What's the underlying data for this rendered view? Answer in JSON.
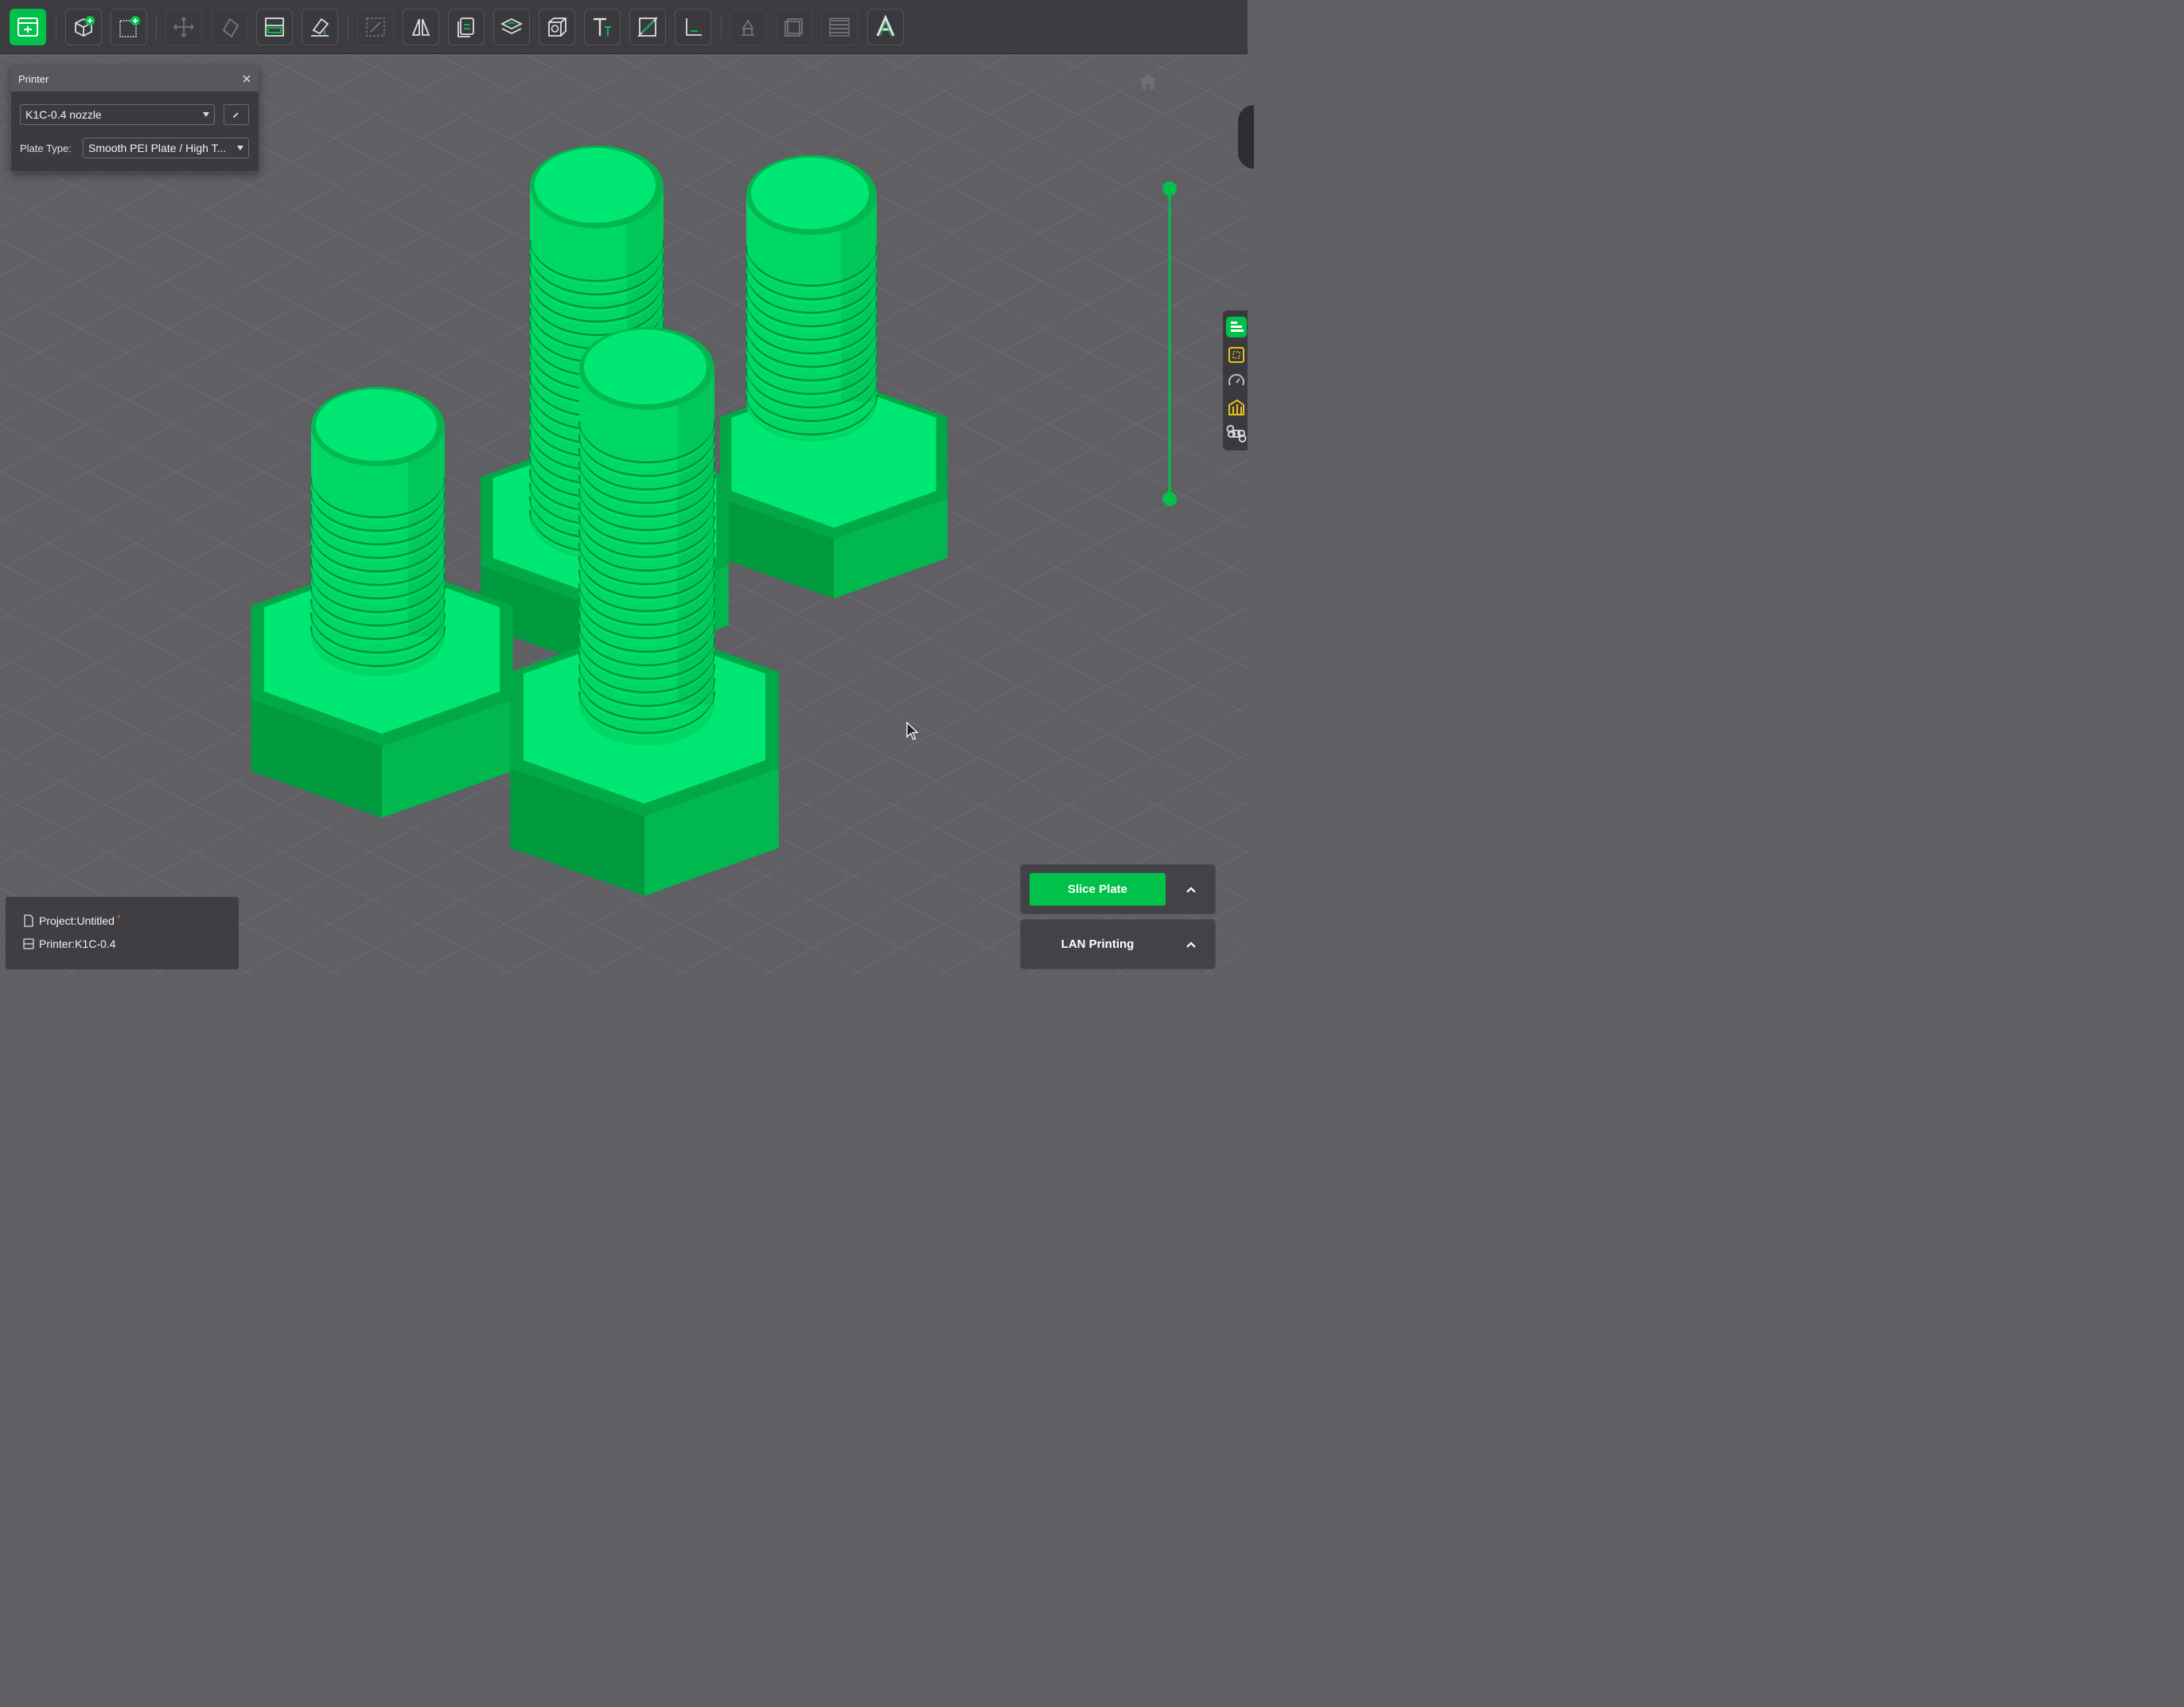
{
  "toolbar": {
    "buttons": [
      {
        "icon": "prepare-view-icon",
        "active": true
      },
      {
        "icon": "add-object-icon"
      },
      {
        "icon": "add-plate-icon"
      },
      {
        "icon": "move-icon",
        "disabled": true
      },
      {
        "icon": "rotate-icon",
        "disabled": true
      },
      {
        "icon": "arrange-icon"
      },
      {
        "icon": "lay-on-face-icon"
      },
      {
        "icon": "scale-icon",
        "disabled": true
      },
      {
        "icon": "mirror-icon"
      },
      {
        "icon": "copy-icon"
      },
      {
        "icon": "auto-orient-icon"
      },
      {
        "icon": "hollow-icon"
      },
      {
        "icon": "text-icon"
      },
      {
        "icon": "cut-icon"
      },
      {
        "icon": "measure-icon"
      },
      {
        "icon": "support-paint-icon",
        "disabled": true
      },
      {
        "icon": "seam-paint-icon",
        "disabled": true
      },
      {
        "icon": "variable-layer-icon",
        "disabled": true
      },
      {
        "icon": "emboss-font-icon"
      }
    ]
  },
  "printer_panel": {
    "title": "Printer",
    "printer_select": "K1C-0.4 nozzle",
    "plate_type_label": "Plate Type:",
    "plate_type_select": "Smooth PEI Plate / High T..."
  },
  "project_info": {
    "project": "Project:Untitled",
    "dirty_marker": "*",
    "printer": "Printer:K1C-0.4"
  },
  "actions": {
    "slice": "Slice Plate",
    "lan": "LAN Printing"
  },
  "colors": {
    "accent": "#00c24a",
    "model": "#00e16a",
    "background": "#5f5f64"
  }
}
